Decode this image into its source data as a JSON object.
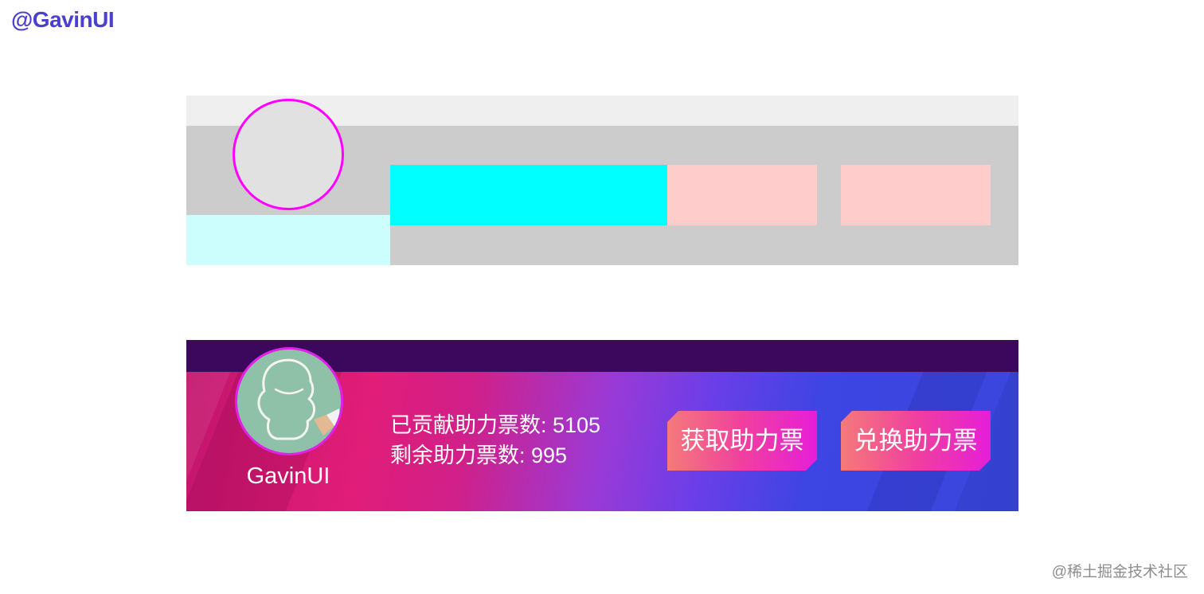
{
  "handle": "@GavinUI",
  "watermark": "@稀土掘金技术社区",
  "colors": {
    "handle": "#4b3fd0",
    "avatar_border": "#ff00ff",
    "header_bar": "#3b085e",
    "gradient_start": "#e11d78",
    "gradient_end": "#3946dc",
    "button_gradient": [
      "#f57a7a",
      "#e61ed8"
    ],
    "wireframe_info": "#00ffff",
    "wireframe_button": "#ffcccc",
    "wireframe_name": "#ccfefe"
  },
  "user": {
    "name": "GavinUI",
    "avatar_icon": "qq-penguin-chalk-icon"
  },
  "stats": {
    "contributed_label": "已贡献助力票数: 5105",
    "remaining_label": "剩余助力票数: 995"
  },
  "buttons": {
    "get_votes": "获取助力票",
    "exchange_votes": "兑换助力票"
  }
}
